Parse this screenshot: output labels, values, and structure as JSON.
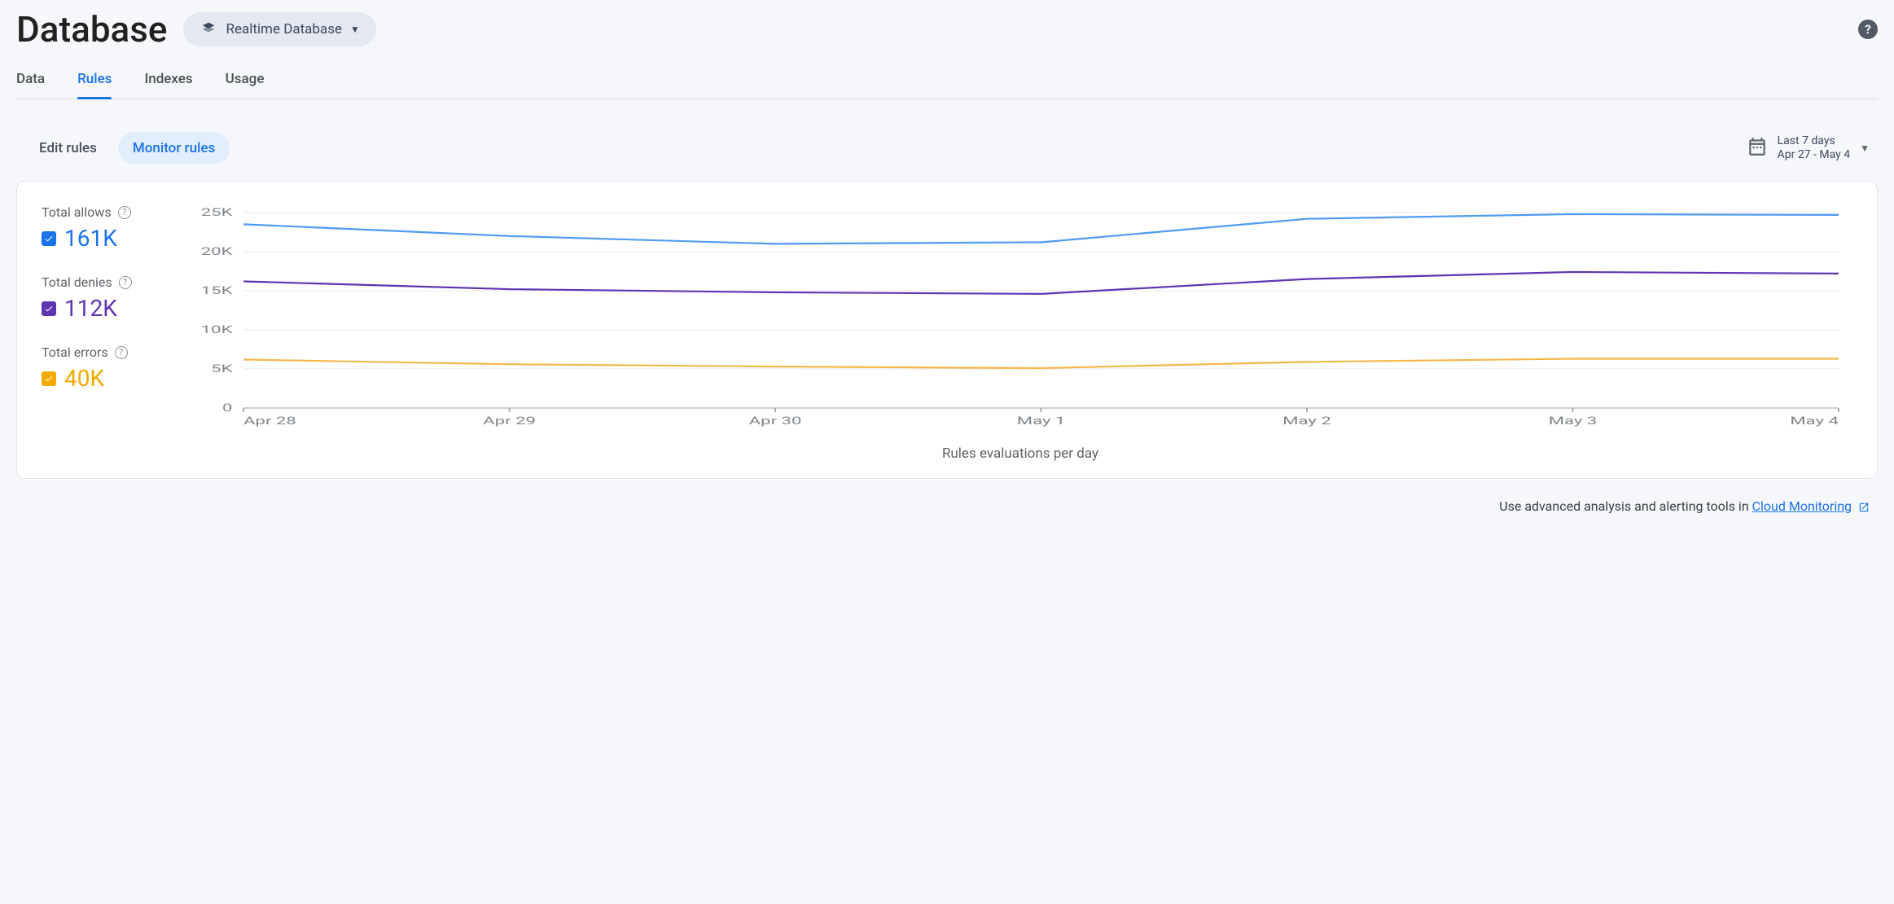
{
  "header": {
    "title": "Database",
    "selector_label": "Realtime Database"
  },
  "tabs": [
    {
      "label": "Data",
      "active": false
    },
    {
      "label": "Rules",
      "active": true
    },
    {
      "label": "Indexes",
      "active": false
    },
    {
      "label": "Usage",
      "active": false
    }
  ],
  "subtabs": [
    {
      "label": "Edit rules",
      "active": false
    },
    {
      "label": "Monitor rules",
      "active": true
    }
  ],
  "date_range": {
    "label": "Last 7 days",
    "range": "Apr 27 - May 4"
  },
  "legend": {
    "allows": {
      "label": "Total allows",
      "value": "161K",
      "color": "#1a73e8"
    },
    "denies": {
      "label": "Total denies",
      "value": "112K",
      "color": "#5e35b1"
    },
    "errors": {
      "label": "Total errors",
      "value": "40K",
      "color": "#f2a900"
    }
  },
  "chart_data": {
    "type": "line",
    "title": "",
    "xlabel": "Rules evaluations per day",
    "ylabel": "",
    "ylim": [
      0,
      25000
    ],
    "y_ticks": [
      0,
      5000,
      10000,
      15000,
      20000,
      25000
    ],
    "y_tick_labels": [
      "0",
      "5K",
      "10K",
      "15K",
      "20K",
      "25K"
    ],
    "categories": [
      "Apr 28",
      "Apr 29",
      "Apr 30",
      "May 1",
      "May 2",
      "May 3",
      "May 4"
    ],
    "series": [
      {
        "name": "allows",
        "color": "#4f9cf5",
        "values": [
          23500,
          22000,
          21000,
          21200,
          24200,
          24800,
          24700
        ]
      },
      {
        "name": "denies",
        "color": "#5e35b1",
        "values": [
          16200,
          15200,
          14800,
          14600,
          16500,
          17400,
          17200
        ]
      },
      {
        "name": "errors",
        "color": "#f2b84a",
        "values": [
          6200,
          5600,
          5300,
          5100,
          5900,
          6300,
          6300
        ]
      }
    ]
  },
  "footer": {
    "prefix": "Use advanced analysis and alerting tools in ",
    "link_text": "Cloud Monitoring"
  }
}
